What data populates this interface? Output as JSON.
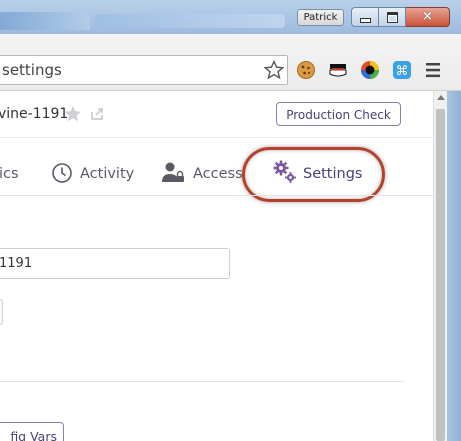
{
  "window": {
    "profile_name": "Patrick",
    "controls": {
      "minimize": "minimize-icon",
      "maximize": "maximize-icon",
      "close": "×"
    }
  },
  "toolbar": {
    "address": "settings",
    "extensions": [
      "cookie-icon",
      "mask-icon",
      "color-wheel-icon",
      "command-icon"
    ],
    "menu_icon": "hamburger-menu-icon"
  },
  "app_header": {
    "app_name": "vine-1191",
    "production_check_label": "Production Check"
  },
  "tabs": [
    {
      "label": "ics",
      "icon": ""
    },
    {
      "label": "Activity",
      "icon": "clock-icon"
    },
    {
      "label": "Access",
      "icon": "person-lock-icon"
    },
    {
      "label": "Settings",
      "icon": "gears-icon",
      "highlighted": true
    }
  ],
  "settings": {
    "app_name_value": "1191",
    "config_vars_label": "fig Vars"
  },
  "colors": {
    "accent": "#79589f",
    "highlight_ring": "#b4412b",
    "button_border": "#8b7db3"
  }
}
